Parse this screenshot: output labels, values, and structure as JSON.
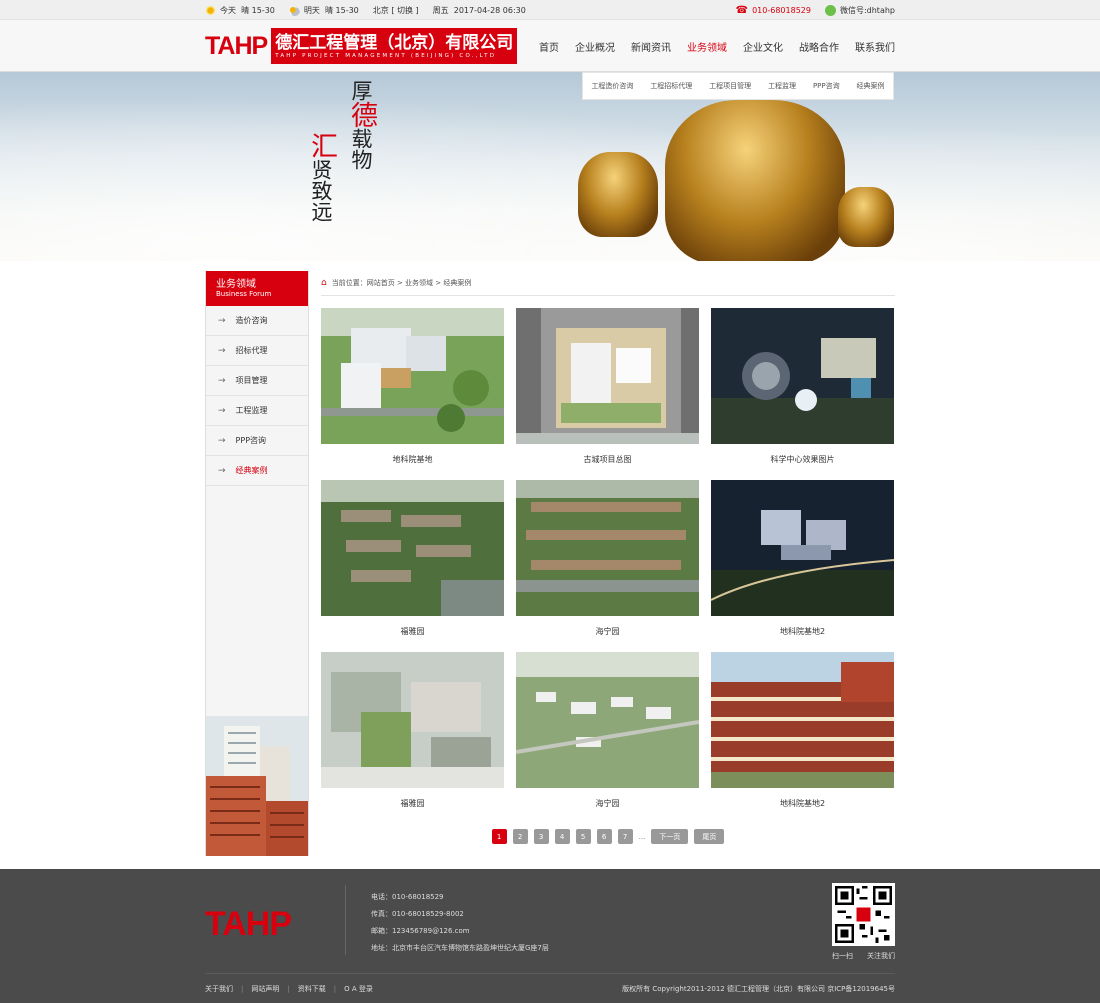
{
  "topbar": {
    "today_label": "今天",
    "today_weather": "晴 15-30",
    "tomorrow_label": "明天",
    "tomorrow_weather": "晴 15-30",
    "city": "北京",
    "switch": "[ 切换 ]",
    "weekday": "周五",
    "datetime": "2017-04-28 06:30",
    "phone": "010-68018529",
    "wechat": "微信号:dhtahp"
  },
  "header": {
    "logo_abbr": "TAHP",
    "logo_cn": "德汇工程管理（北京）有限公司",
    "logo_en": "TAHP PROJECT MANAGEMENT (BEIJING) CO.,LTD",
    "nav": [
      "首页",
      "企业概况",
      "新闻资讯",
      "业务领域",
      "企业文化",
      "战略合作",
      "联系我们"
    ],
    "nav_active": "业务领域",
    "subnav": [
      "工程造价咨询",
      "工程招标代理",
      "工程项目管理",
      "工程监理",
      "PPP咨询",
      "经典案例"
    ]
  },
  "banner": {
    "line1": "厚德载物",
    "line2": "汇贤致远"
  },
  "sidebar": {
    "title_cn": "业务领域",
    "title_en": "Business Forum",
    "items": [
      {
        "label": "造价咨询"
      },
      {
        "label": "招标代理"
      },
      {
        "label": "项目管理"
      },
      {
        "label": "工程监理"
      },
      {
        "label": "PPP咨询"
      },
      {
        "label": "经典案例"
      }
    ],
    "active": "经典案例"
  },
  "breadcrumb": {
    "prefix": "当前位置：",
    "items": [
      "网站首页",
      "业务领域",
      "经典案例"
    ],
    "separator": ">"
  },
  "gallery": [
    {
      "caption": "地科院基地"
    },
    {
      "caption": "古城项目总图"
    },
    {
      "caption": "科学中心效果图片"
    },
    {
      "caption": "福雅园"
    },
    {
      "caption": "海宁园"
    },
    {
      "caption": "地科院基地2"
    },
    {
      "caption": "福雅园"
    },
    {
      "caption": "海宁园"
    },
    {
      "caption": "地科院基地2"
    }
  ],
  "pagination": {
    "pages": [
      "1",
      "2",
      "3",
      "4",
      "5",
      "6",
      "7"
    ],
    "current": "1",
    "ellipsis": "...",
    "next": "下一页",
    "last": "尾页"
  },
  "footer": {
    "logo": "TAHP",
    "phone": "电话：010-68018529",
    "fax": "传真：010-68018529-8002",
    "email": "邮箱：123456789@126.com",
    "address": "地址：北京市丰台区汽车博物馆东路盈坤世纪大厦G座7层",
    "qr_scan": "扫一扫",
    "qr_follow": "关注我们",
    "links": [
      "关于我们",
      "网站声明",
      "资料下载",
      "O A 登录"
    ],
    "copyright": "版权所有 Copyright2011-2012 德汇工程管理（北京）有限公司  京ICP备12019645号"
  },
  "colors": {
    "brand": "#d7000f",
    "footer_bg": "#4b4b4b"
  }
}
